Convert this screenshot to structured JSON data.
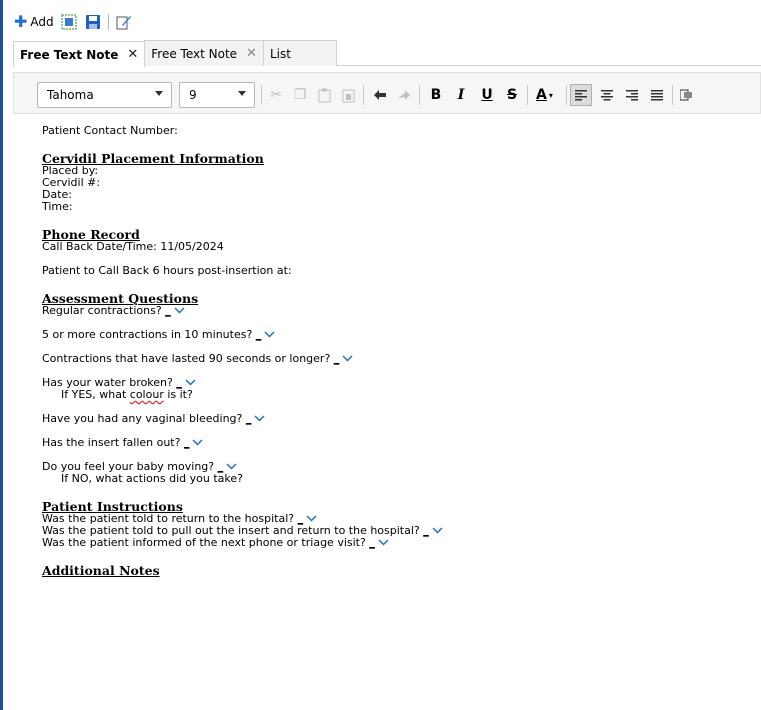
{
  "toolbar": {
    "add_label": "Add",
    "icons": [
      "plus-icon",
      "fit-icon",
      "save-icon",
      "edit-note-icon"
    ]
  },
  "tabs": [
    {
      "label": "Free Text Note",
      "active": true,
      "closable": true
    },
    {
      "label": "Free Text Note",
      "active": false,
      "closable": true
    },
    {
      "label": "List",
      "active": false,
      "closable": false
    }
  ],
  "format": {
    "font_name": "Tahoma",
    "font_size": "9",
    "bold": "B",
    "italic": "I",
    "underline": "U",
    "strike": "S",
    "font_color": "A"
  },
  "doc": {
    "patient_contact": "Patient Contact Number:",
    "cervidil_heading": "Cervidil Placement Information",
    "placed_by": "Placed by:",
    "cervidil_num": "Cervidil #:",
    "date": "Date:",
    "time": "Time:",
    "phone_heading": "Phone Record",
    "call_back": "Call Back Date/Time: 11/05/2024",
    "call_back_6": "Patient to Call Back 6 hours post-insertion at:",
    "assessment_heading": "Assessment Questions",
    "q_regular": "Regular contractions? ",
    "q_5more": "5 or more contractions in 10 minutes? ",
    "q_90sec": "Contractions that have lasted 90 seconds or longer? ",
    "q_water": "Has your water broken? ",
    "q_water_yes_pre": "If YES, what ",
    "q_water_yes_word": "colour",
    "q_water_yes_post": " is it?",
    "q_bleeding": "Have you had any vaginal bleeding? ",
    "q_insert": "Has the insert fallen out? ",
    "q_baby": "Do you feel your baby moving? ",
    "q_baby_no": "If NO, what actions did you take?",
    "instructions_heading": "Patient Instructions",
    "i_return": "Was the patient told to return to the hospital? ",
    "i_pullout": "Was the patient told to pull out the insert and return to the hospital? ",
    "i_informed": "Was the patient informed of the next phone or triage visit? ",
    "blank_marker": "_",
    "additional_heading": "Additional Notes"
  },
  "colors": {
    "accent": "#1e6fd0",
    "left_bar": "#1f4e9c",
    "spell_error": "#dd2222"
  }
}
